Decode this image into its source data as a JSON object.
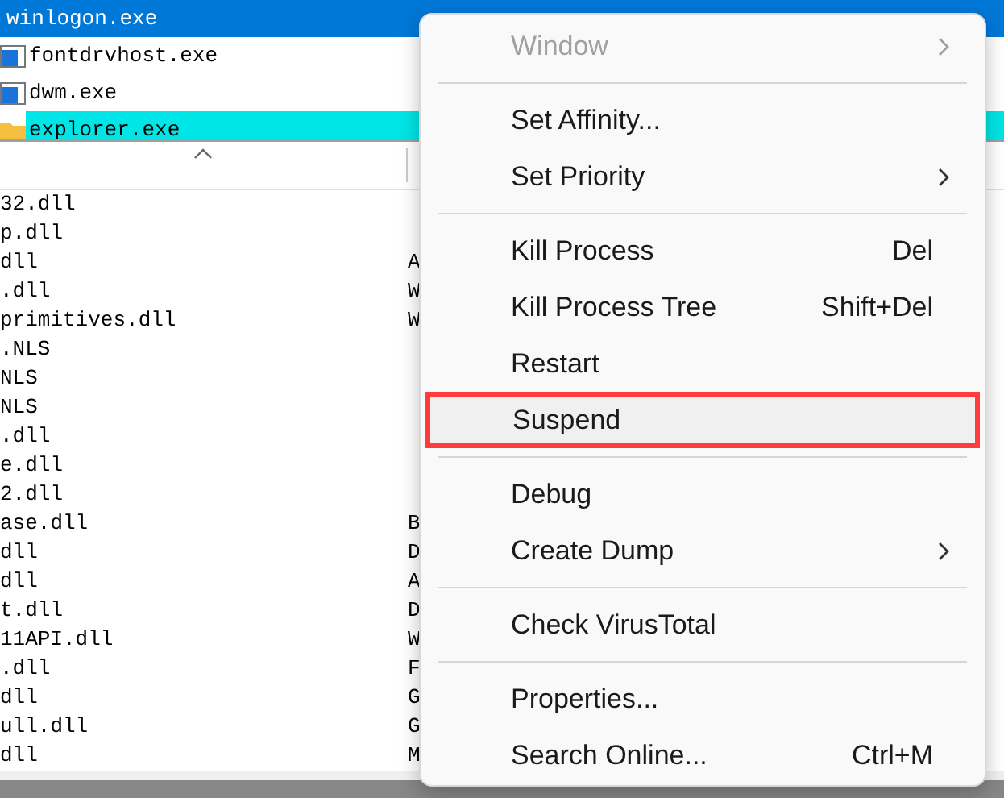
{
  "processes": [
    {
      "name": "winlogon.exe",
      "kind": "plain",
      "selected": true
    },
    {
      "name": "fontdrvhost.exe",
      "kind": "app",
      "selected": false
    },
    {
      "name": "dwm.exe",
      "kind": "app",
      "selected": false
    },
    {
      "name": "explorer.exe",
      "kind": "shell",
      "selected": false,
      "color": "#00e5e5"
    }
  ],
  "modules": [
    {
      "column_1": "32.dll"
    },
    {
      "column_1": "p.dll"
    },
    {
      "column_1": "dll",
      "column_2": "A"
    },
    {
      "column_1": ".dll",
      "column_2": "W"
    },
    {
      "column_1": "primitives.dll",
      "column_2": "W"
    },
    {
      "column_1": ".NLS"
    },
    {
      "column_1": "NLS"
    },
    {
      "column_1": "NLS"
    },
    {
      "column_1": ".dll"
    },
    {
      "column_1": "e.dll"
    },
    {
      "column_1": "2.dll"
    },
    {
      "column_1": "ase.dll",
      "column_2": "B"
    },
    {
      "column_1": "dll",
      "column_2": "D"
    },
    {
      "column_1": "dll",
      "column_2": "A"
    },
    {
      "column_1": "t.dll",
      "column_2": "D"
    },
    {
      "column_1": "11API.dll",
      "column_2": "W"
    },
    {
      "column_1": ".dll",
      "column_2": "F"
    },
    {
      "column_1": "dll",
      "column_2": "G"
    },
    {
      "column_1": "ull.dll",
      "column_2": "G"
    },
    {
      "column_1": "dll",
      "column_2": "M"
    }
  ],
  "context_menu": {
    "groups": [
      [
        {
          "label": "Window",
          "disabled": true,
          "submenu": true,
          "highlighted": false
        }
      ],
      [
        {
          "label": "Set Affinity...",
          "disabled": false,
          "submenu": false,
          "highlighted": false
        },
        {
          "label": "Set Priority",
          "disabled": false,
          "submenu": true,
          "highlighted": false
        }
      ],
      [
        {
          "label": "Kill Process",
          "shortcut": "Del",
          "disabled": false,
          "submenu": false,
          "highlighted": false
        },
        {
          "label": "Kill Process Tree",
          "shortcut": "Shift+Del",
          "disabled": false,
          "submenu": false,
          "highlighted": false
        },
        {
          "label": "Restart",
          "disabled": false,
          "submenu": false,
          "highlighted": false
        },
        {
          "label": "Suspend",
          "disabled": false,
          "submenu": false,
          "highlighted": true
        }
      ],
      [
        {
          "label": "Debug",
          "disabled": false,
          "submenu": false,
          "highlighted": false
        },
        {
          "label": "Create Dump",
          "disabled": false,
          "submenu": true,
          "highlighted": false
        }
      ],
      [
        {
          "label": "Check VirusTotal",
          "disabled": false,
          "submenu": false,
          "highlighted": false
        }
      ],
      [
        {
          "label": "Properties...",
          "disabled": false,
          "submenu": false,
          "highlighted": false
        },
        {
          "label": "Search Online...",
          "shortcut": "Ctrl+M",
          "disabled": false,
          "submenu": false,
          "highlighted": false
        }
      ]
    ]
  }
}
